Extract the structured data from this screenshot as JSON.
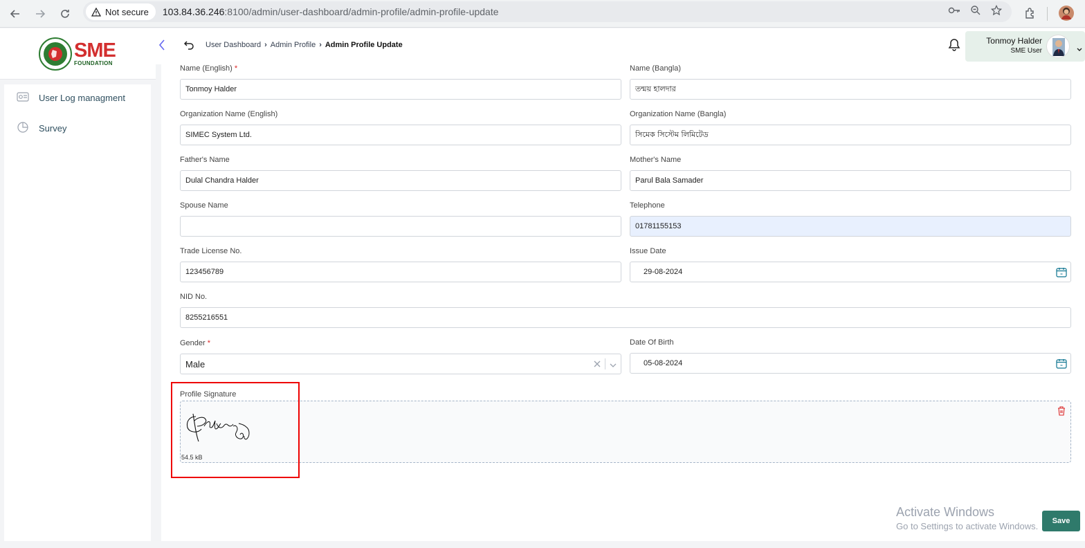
{
  "browser": {
    "security_label": "Not secure",
    "url_host": "103.84.36.246",
    "url_path": ":8100/admin/user-dashboard/admin-profile/admin-profile-update"
  },
  "logo": {
    "brand": "SME",
    "sub": "FOUNDATION"
  },
  "breadcrumb": {
    "items": [
      "User Dashboard",
      "Admin Profile"
    ],
    "current": "Admin Profile Update"
  },
  "user": {
    "name": "Tonmoy Halder",
    "role": "SME User"
  },
  "sidebar": {
    "items": [
      {
        "label": "User Log managment",
        "icon": "log-icon"
      },
      {
        "label": "Survey",
        "icon": "pie-chart-icon"
      }
    ]
  },
  "form": {
    "name_en": {
      "label": "Name (English)",
      "required": "*",
      "value": "Tonmoy Halder"
    },
    "name_bn": {
      "label": "Name (Bangla)",
      "value": "তন্ময় হালদার"
    },
    "org_en": {
      "label": "Organization Name (English)",
      "value": "SIMEC System Ltd."
    },
    "org_bn": {
      "label": "Organization Name (Bangla)",
      "value": "সিমেক সিস্টেম লিমিটেড"
    },
    "father": {
      "label": "Father's Name",
      "value": "Dulal Chandra Halder"
    },
    "mother": {
      "label": "Mother's Name",
      "value": "Parul Bala Samader"
    },
    "spouse": {
      "label": "Spouse Name",
      "value": ""
    },
    "telephone": {
      "label": "Telephone",
      "value": "01781155153"
    },
    "trade": {
      "label": "Trade License No.",
      "value": "123456789"
    },
    "issue_date": {
      "label": "Issue Date",
      "value": "29-08-2024"
    },
    "nid": {
      "label": "NID No.",
      "value": "8255216551"
    },
    "gender": {
      "label": "Gender",
      "required": "*",
      "value": "Male"
    },
    "dob": {
      "label": "Date Of Birth",
      "value": "05-08-2024"
    },
    "signature": {
      "label": "Profile Signature",
      "size": "54.5 kB"
    }
  },
  "watermark": {
    "line1": "Activate Windows",
    "line2": "Go to Settings to activate Windows."
  },
  "save_label": "Save"
}
